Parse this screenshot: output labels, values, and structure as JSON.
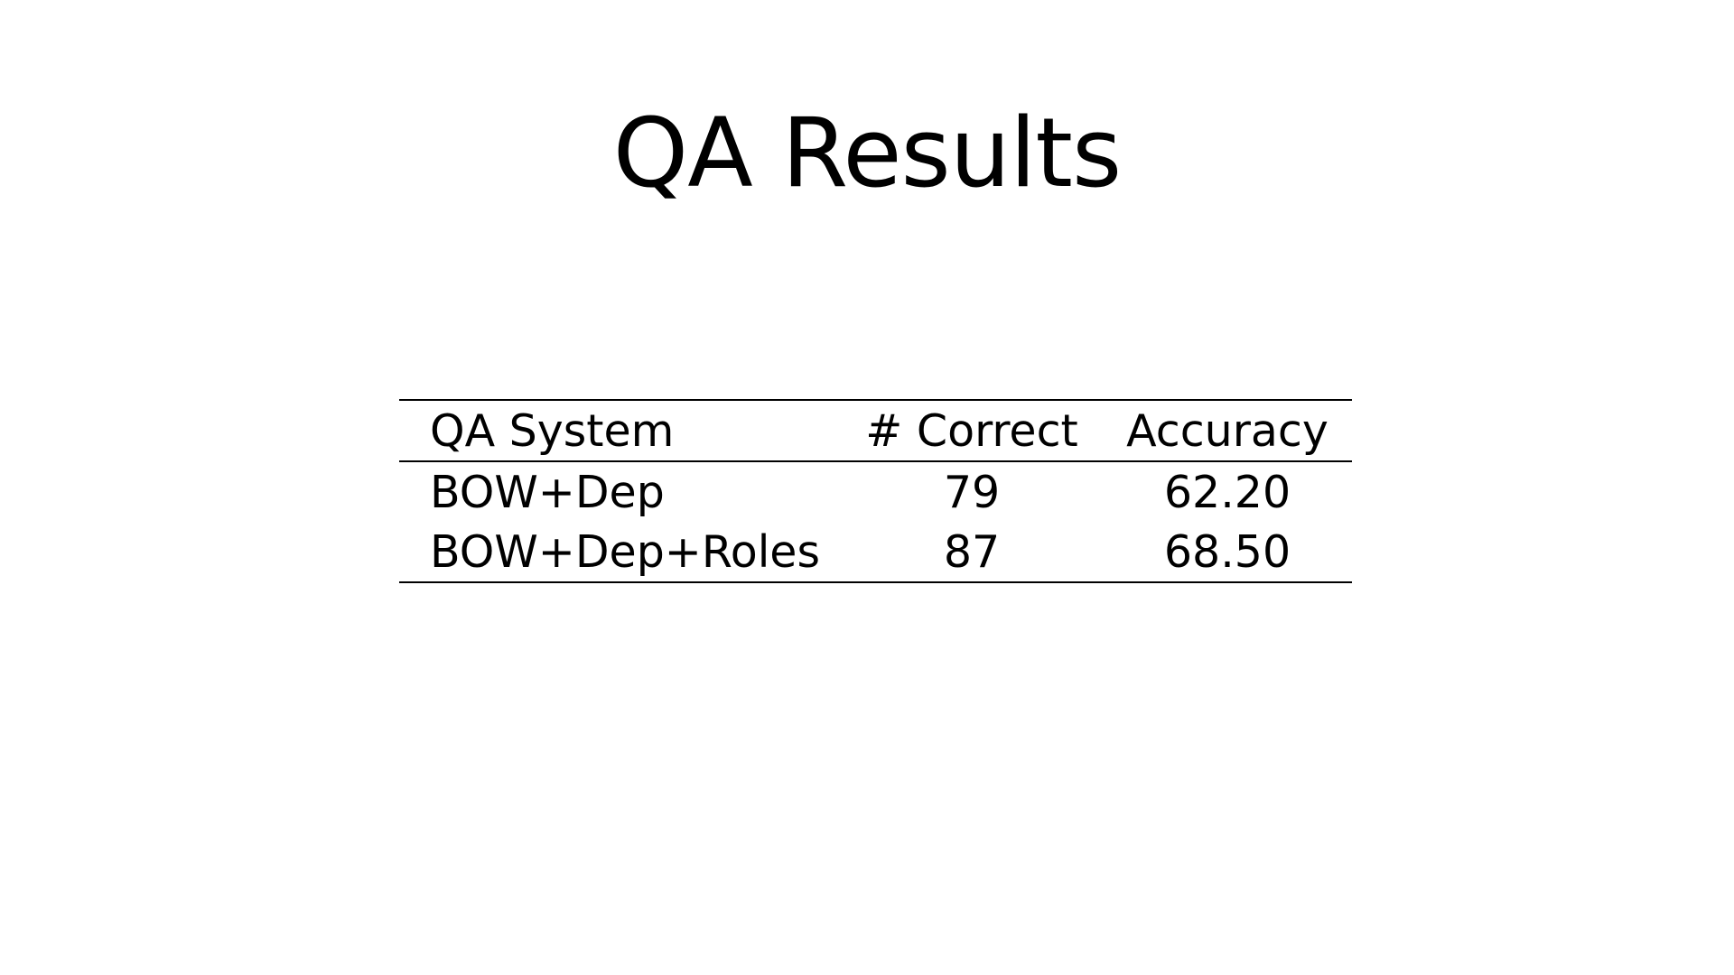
{
  "slide": {
    "title": "QA Results"
  },
  "table": {
    "headers": {
      "system": "QA System",
      "correct": "# Correct",
      "accuracy": "Accuracy"
    },
    "rows": [
      {
        "system": "BOW+Dep",
        "correct": "79",
        "accuracy": "62.20"
      },
      {
        "system": "BOW+Dep+Roles",
        "correct": "87",
        "accuracy": "68.50"
      }
    ]
  },
  "colors": {
    "background": "#ffffff",
    "text": "#000000",
    "rule": "#000000"
  }
}
